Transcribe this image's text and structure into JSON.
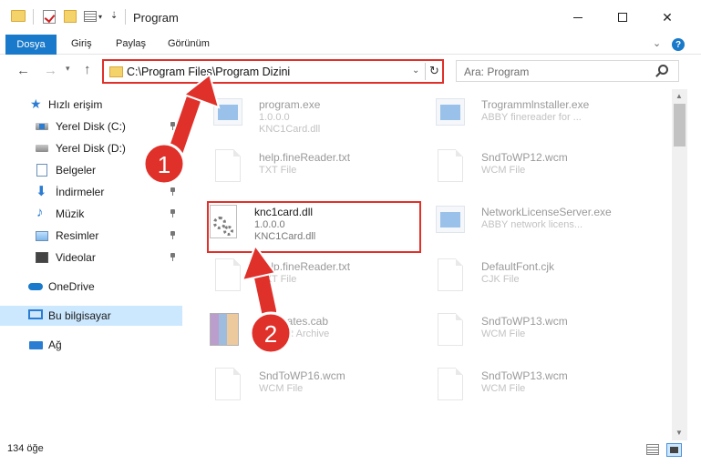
{
  "window": {
    "title": "Program",
    "min_glyph": "",
    "max_glyph": "",
    "close_glyph": "✕"
  },
  "ribbon": {
    "tabs": [
      {
        "label": "Dosya",
        "active": true
      },
      {
        "label": "Giriş"
      },
      {
        "label": "Paylaş"
      },
      {
        "label": "Görünüm"
      }
    ],
    "help_glyph": "?"
  },
  "navigation": {
    "back_glyph": "←",
    "forward_glyph": "→",
    "up_glyph": "↑",
    "address_path": "C:\\Program Files\\Program Dizini",
    "refresh_glyph": "↻",
    "search_placeholder": "Ara: Program"
  },
  "sidebar": {
    "items": [
      {
        "label": "Hızlı erişim",
        "icon": "star-icon"
      },
      {
        "label": "Yerel Disk (C:)",
        "icon": "drive-icon",
        "pinned": true
      },
      {
        "label": "Yerel Disk (D:)",
        "icon": "drive-icon",
        "pinned": true
      },
      {
        "label": "Belgeler",
        "icon": "documents-icon",
        "pinned": true
      },
      {
        "label": "İndirmeler",
        "icon": "downloads-icon",
        "pinned": true
      },
      {
        "label": "Müzik",
        "icon": "music-icon",
        "pinned": true
      },
      {
        "label": "Resimler",
        "icon": "pictures-icon",
        "pinned": true
      },
      {
        "label": "Videolar",
        "icon": "videos-icon",
        "pinned": true
      },
      {
        "label": "OneDrive",
        "icon": "onedrive-icon"
      },
      {
        "label": "Bu bilgisayar",
        "icon": "computer-icon",
        "selected": true
      },
      {
        "label": "Ağ",
        "icon": "network-icon"
      }
    ]
  },
  "files": [
    {
      "name": "program.exe",
      "line1": "1.0.0.0",
      "line2": "KNC1Card.dll",
      "type": "exe",
      "faded": true
    },
    {
      "name": "Trogrammlnstaller.exe",
      "line1": "ABBY finereader for ...",
      "type": "exe",
      "faded": true
    },
    {
      "name": "help.fineReader.txt",
      "line1": "TXT File",
      "type": "doc",
      "faded": true
    },
    {
      "name": "SndToWP12.wcm",
      "line1": "WCM File",
      "type": "doc",
      "faded": true
    },
    {
      "name": "knc1card.dll",
      "line1": "1.0.0.0",
      "line2": "KNC1Card.dll",
      "type": "dll",
      "faded": false
    },
    {
      "name": "NetworkLicenseServer.exe",
      "line1": "ABBY network licens...",
      "type": "exe",
      "faded": true
    },
    {
      "name": "help.fineReader.txt",
      "line1": "TXT File",
      "type": "doc",
      "faded": true
    },
    {
      "name": "DefaultFont.cjk",
      "line1": "CJK File",
      "type": "doc",
      "faded": true
    },
    {
      "name": "certificates.cab",
      "line1": "WinRAR Archive",
      "type": "rar",
      "faded": true
    },
    {
      "name": "SndToWP13.wcm",
      "line1": "WCM File",
      "type": "doc",
      "faded": true
    },
    {
      "name": "SndToWP16.wcm",
      "line1": "WCM File",
      "type": "doc",
      "faded": true
    },
    {
      "name": "SndToWP13.wcm",
      "line1": "WCM File",
      "type": "doc",
      "faded": true
    }
  ],
  "status": {
    "item_count": "134 öğe"
  },
  "annotations": {
    "step1": "1",
    "step2": "2",
    "color": "#e0302a"
  }
}
